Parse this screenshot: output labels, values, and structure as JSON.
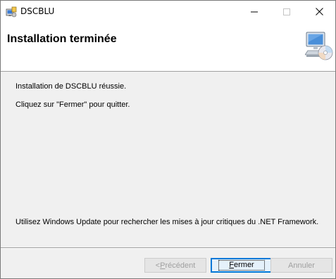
{
  "window": {
    "title": "DSCBLU"
  },
  "banner": {
    "title": "Installation terminée"
  },
  "content": {
    "line1": "Installation de DSCBLU réussie.",
    "line2": "Cliquez sur \"Fermer\" pour quitter.",
    "line3": "Utilisez Windows Update pour rechercher les mises à jour critiques du .NET Framework."
  },
  "buttons": {
    "prev_prefix": "< ",
    "prev_accel": "P",
    "prev_rest": "récédent",
    "close_accel": "F",
    "close_rest": "ermer",
    "cancel": "Annuler"
  },
  "icons": {
    "app": "installer-icon",
    "setup": "computer-cd-icon",
    "minimize": "minimize-icon",
    "maximize": "maximize-icon",
    "close": "close-icon"
  },
  "colors": {
    "accent": "#0078d7",
    "dialog_bg": "#f0f0f0",
    "disabled_text": "#a0a0a0"
  }
}
